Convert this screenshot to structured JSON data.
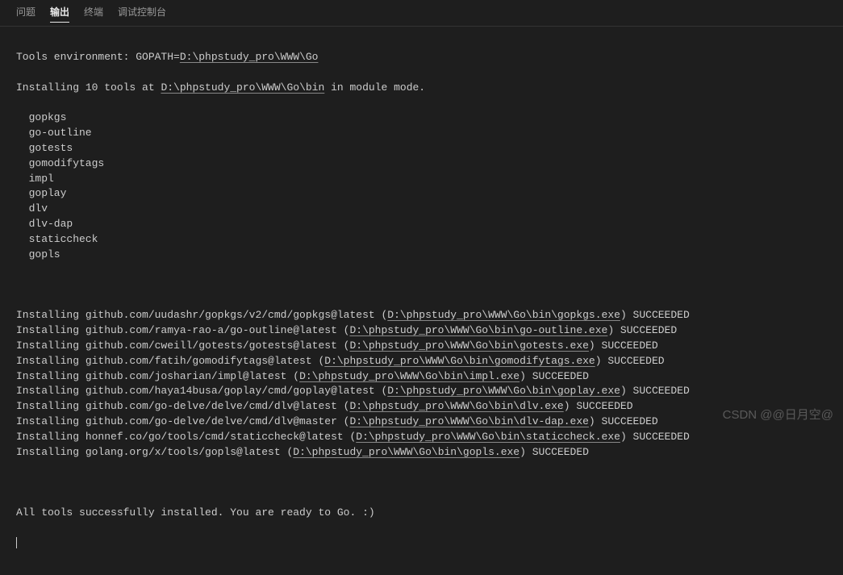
{
  "tabs": {
    "problems": "问题",
    "output": "输出",
    "terminal": "终端",
    "debug": "调试控制台"
  },
  "header": {
    "env_prefix": "Tools environment: GOPATH=",
    "env_path": "D:\\phpstudy_pro\\WWW\\Go",
    "install_prefix": "Installing 10 tools at ",
    "install_path": "D:\\phpstudy_pro\\WWW\\Go\\bin",
    "install_suffix": " in module mode."
  },
  "tools": [
    "gopkgs",
    "go-outline",
    "gotests",
    "gomodifytags",
    "impl",
    "goplay",
    "dlv",
    "dlv-dap",
    "staticcheck",
    "gopls"
  ],
  "installs": [
    {
      "pkg": "github.com/uudashr/gopkgs/v2/cmd/gopkgs@latest",
      "path": "D:\\phpstudy_pro\\WWW\\Go\\bin\\gopkgs.exe",
      "status": "SUCCEEDED"
    },
    {
      "pkg": "github.com/ramya-rao-a/go-outline@latest",
      "path": "D:\\phpstudy_pro\\WWW\\Go\\bin\\go-outline.exe",
      "status": "SUCCEEDED"
    },
    {
      "pkg": "github.com/cweill/gotests/gotests@latest",
      "path": "D:\\phpstudy_pro\\WWW\\Go\\bin\\gotests.exe",
      "status": "SUCCEEDED"
    },
    {
      "pkg": "github.com/fatih/gomodifytags@latest",
      "path": "D:\\phpstudy_pro\\WWW\\Go\\bin\\gomodifytags.exe",
      "status": "SUCCEEDED"
    },
    {
      "pkg": "github.com/josharian/impl@latest",
      "path": "D:\\phpstudy_pro\\WWW\\Go\\bin\\impl.exe",
      "status": "SUCCEEDED"
    },
    {
      "pkg": "github.com/haya14busa/goplay/cmd/goplay@latest",
      "path": "D:\\phpstudy_pro\\WWW\\Go\\bin\\goplay.exe",
      "status": "SUCCEEDED"
    },
    {
      "pkg": "github.com/go-delve/delve/cmd/dlv@latest",
      "path": "D:\\phpstudy_pro\\WWW\\Go\\bin\\dlv.exe",
      "status": "SUCCEEDED"
    },
    {
      "pkg": "github.com/go-delve/delve/cmd/dlv@master",
      "path": "D:\\phpstudy_pro\\WWW\\Go\\bin\\dlv-dap.exe",
      "status": "SUCCEEDED"
    },
    {
      "pkg": "honnef.co/go/tools/cmd/staticcheck@latest",
      "path": "D:\\phpstudy_pro\\WWW\\Go\\bin\\staticcheck.exe",
      "status": "SUCCEEDED"
    },
    {
      "pkg": "golang.org/x/tools/gopls@latest",
      "path": "D:\\phpstudy_pro\\WWW\\Go\\bin\\gopls.exe",
      "status": "SUCCEEDED"
    }
  ],
  "footer": "All tools successfully installed. You are ready to Go. :)",
  "watermark": "CSDN @@日月空@"
}
